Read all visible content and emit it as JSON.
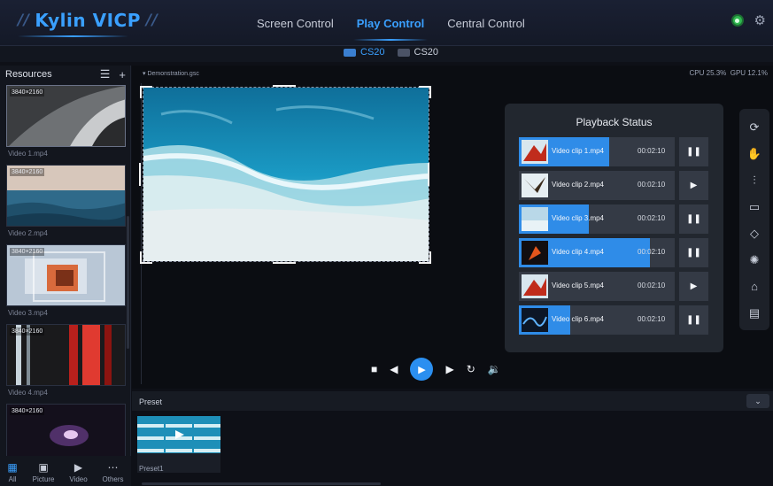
{
  "app": {
    "logo": "Kylin VICP",
    "logo_slashes_left": "//",
    "logo_slashes_right": "//"
  },
  "nav": {
    "items": [
      {
        "label": "Screen Control",
        "active": false
      },
      {
        "label": "Play Control",
        "active": true
      },
      {
        "label": "Central Control",
        "active": false
      }
    ]
  },
  "top_icons": {
    "status": "online-status-icon",
    "settings": "gear-icon"
  },
  "devices": [
    {
      "label": "CS20",
      "active": true
    },
    {
      "label": "CS20",
      "active": false
    }
  ],
  "sidebar": {
    "title": "Resources",
    "items": [
      {
        "resolution": "3840×2160",
        "name": "Video 1.mp4",
        "thumb": "abstract-gray"
      },
      {
        "resolution": "3840×2160",
        "name": "Video 2.mp4",
        "thumb": "ocean"
      },
      {
        "resolution": "3840×2160",
        "name": "Video 3.mp4",
        "thumb": "glass-cube"
      },
      {
        "resolution": "3840×2160",
        "name": "Video 4.mp4",
        "thumb": "red-streaks"
      },
      {
        "resolution": "3840×2160",
        "name": "",
        "thumb": "nebula"
      }
    ],
    "filters": [
      {
        "label": "All",
        "icon": "grid-icon",
        "active": true
      },
      {
        "label": "Picture",
        "icon": "picture-icon",
        "active": false
      },
      {
        "label": "Video",
        "icon": "video-icon",
        "active": false
      },
      {
        "label": "Others",
        "icon": "more-icon",
        "active": false
      }
    ]
  },
  "main": {
    "file": "Demonstration.gsc",
    "cpu": "CPU 25.3%",
    "gpu": "GPU 12.1%"
  },
  "playback": {
    "title": "Playback Status",
    "rows": [
      {
        "name": "Video clip 1.mp4",
        "time": "00:02:10",
        "progress": 0.58,
        "control": "pause"
      },
      {
        "name": "Video clip 2.mp4",
        "time": "00:02:10",
        "progress": 0.0,
        "control": "play"
      },
      {
        "name": "Video clip 3.mp4",
        "time": "00:02:10",
        "progress": 0.45,
        "control": "pause"
      },
      {
        "name": "Video clip 4.mp4",
        "time": "00:02:10",
        "progress": 0.84,
        "control": "pause"
      },
      {
        "name": "Video clip 5.mp4",
        "time": "00:02:10",
        "progress": 0.0,
        "control": "play"
      },
      {
        "name": "Video clip 6.mp4",
        "time": "00:02:10",
        "progress": 0.33,
        "control": "pause"
      }
    ]
  },
  "transport": {
    "stop": "stop-icon",
    "prev": "previous-icon",
    "play": "play-icon",
    "next": "next-icon",
    "loop": "loop-icon",
    "volume": "volume-icon"
  },
  "right_toolbar": [
    "refresh-icon",
    "hand-icon",
    "audio-icon",
    "monitor-icon",
    "location-icon",
    "settings-icon",
    "clear-icon",
    "save-icon"
  ],
  "preset": {
    "title": "Preset",
    "items": [
      {
        "name": "Preset1"
      }
    ]
  },
  "colors": {
    "accent": "#2b8ff0",
    "panel": "#22272f",
    "background": "#0e1017"
  }
}
